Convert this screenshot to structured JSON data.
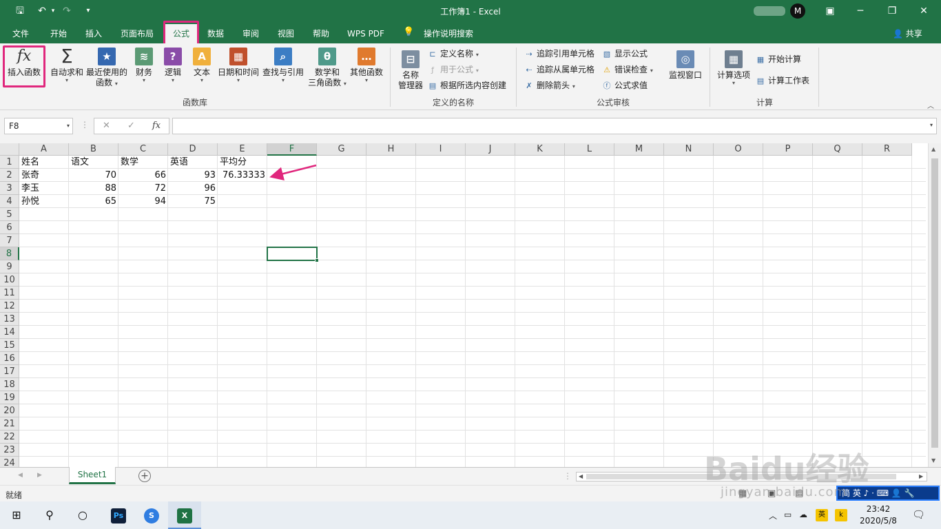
{
  "window": {
    "title": "工作簿1  -  Excel",
    "minimize_icon": "minimize-icon",
    "restore_icon": "restore-icon",
    "close_icon": "close-icon"
  },
  "quick_access": {
    "save": "save-icon",
    "undo": "undo-icon",
    "redo": "redo-icon",
    "customize": "customize-icon"
  },
  "profile": {
    "initial": "M"
  },
  "tabs": [
    {
      "label": "文件"
    },
    {
      "label": "开始"
    },
    {
      "label": "插入"
    },
    {
      "label": "页面布局"
    },
    {
      "label": "公式"
    },
    {
      "label": "数据"
    },
    {
      "label": "审阅"
    },
    {
      "label": "视图"
    },
    {
      "label": "帮助"
    },
    {
      "label": "WPS PDF"
    },
    {
      "label": "操作说明搜索"
    }
  ],
  "share_label": "共享",
  "ribbon": {
    "function_library": {
      "label": "函数库",
      "insert_function": "插入函数",
      "insert_function_glyph": "fx",
      "autosum": "自动求和",
      "recent_line1": "最近使用的",
      "recent_line2": "函数",
      "financial": "财务",
      "logical": "逻辑",
      "text": "文本",
      "datetime": "日期和时间",
      "lookup": "查找与引用",
      "math_line1": "数学和",
      "math_line2": "三角函数",
      "other": "其他函数"
    },
    "defined_names": {
      "label": "定义的名称",
      "name_manager_line1": "名称",
      "name_manager_line2": "管理器",
      "define_name": "定义名称",
      "use_in_formula": "用于公式",
      "create_from_selection": "根据所选内容创建"
    },
    "formula_auditing": {
      "label": "公式审核",
      "trace_precedents": "追踪引用单元格",
      "trace_dependents": "追踪从属单元格",
      "remove_arrows": "删除箭头",
      "show_formulas": "显示公式",
      "error_checking": "错误检查",
      "evaluate_formula": "公式求值",
      "watch_window": "监视窗口"
    },
    "calculation": {
      "label": "计算",
      "calc_options": "计算选项",
      "calc_now": "开始计算",
      "calc_sheet": "计算工作表"
    }
  },
  "formula_bar": {
    "name_box": "F8",
    "fx": "fx",
    "cancel": "✕",
    "enter": "✓",
    "value": ""
  },
  "grid": {
    "columns": [
      "A",
      "B",
      "C",
      "D",
      "E",
      "F",
      "G",
      "H",
      "I",
      "J",
      "K",
      "L",
      "M",
      "N",
      "O",
      "P",
      "Q",
      "R"
    ],
    "selected_column": "F",
    "row_numbers": [
      "1",
      "2",
      "3",
      "4",
      "5",
      "6",
      "7",
      "8",
      "9",
      "10",
      "11",
      "12",
      "13",
      "14",
      "15",
      "16",
      "17",
      "18",
      "19",
      "20",
      "21",
      "22",
      "23",
      "24"
    ],
    "selected_row": "8",
    "data": [
      [
        "姓名",
        "语文",
        "数学",
        "英语",
        "平均分"
      ],
      [
        "张奇",
        "70",
        "66",
        "93",
        "76.33333"
      ],
      [
        "李玉",
        "88",
        "72",
        "96",
        ""
      ],
      [
        "孙悦",
        "65",
        "94",
        "75",
        ""
      ]
    ]
  },
  "sheets": [
    {
      "label": "Sheet1"
    }
  ],
  "status": {
    "ready": "就绪"
  },
  "ime_bar": "简 英 ♪ · ⌨ 👤 🔧",
  "taskbar": {
    "ps": "Ps",
    "sogou": "S",
    "excel": "X",
    "tray_lang": "英",
    "tray_k": "k",
    "time": "23:42",
    "date": "2020/5/8"
  },
  "watermark": {
    "logo": "Baidu经验",
    "url": "jingyan.baidu.com"
  }
}
